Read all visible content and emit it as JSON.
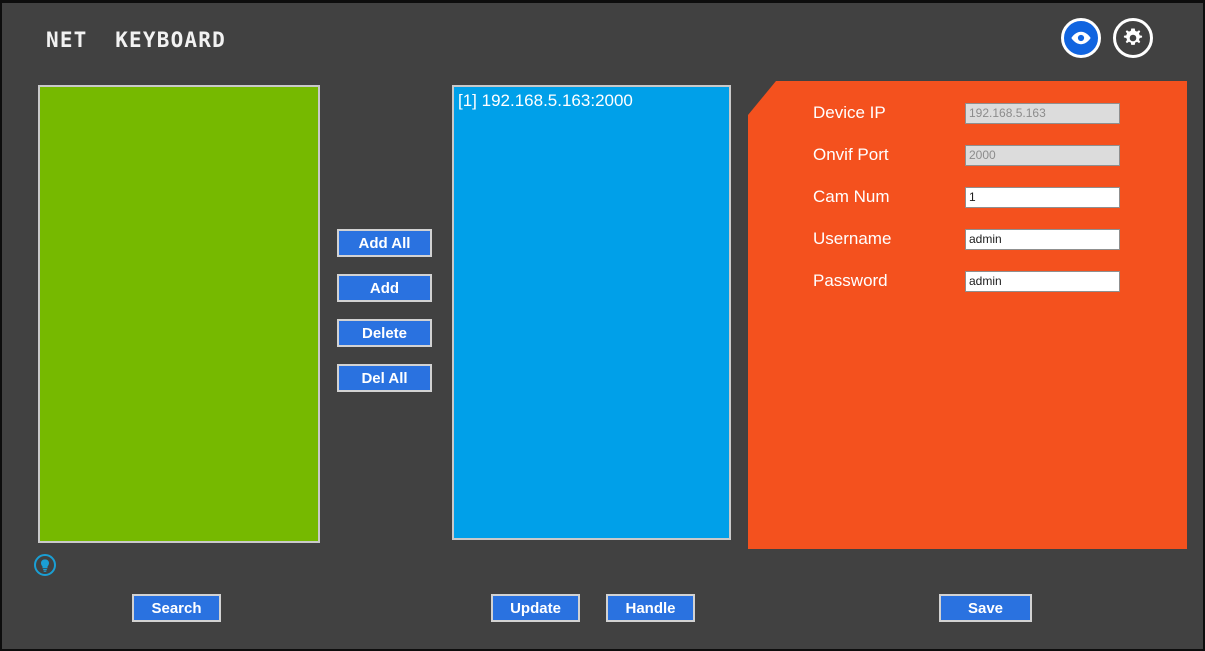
{
  "window": {
    "title": "NET  KEYBOARD",
    "background_color": "#414141"
  },
  "title_icons": [
    {
      "name": "eye-icon",
      "label": "Preview",
      "color": "#1064e0"
    },
    {
      "name": "gear-icon",
      "label": "Settings",
      "color": "#ffffff"
    }
  ],
  "device_list": {
    "name": "searched-device-list",
    "background_color": "#76b900",
    "items": []
  },
  "added_list": {
    "name": "added-device-list",
    "background_color": "#00a0e9",
    "items": [
      {
        "label": "[1] 192.168.5.163:2000"
      }
    ]
  },
  "transfer_buttons": [
    {
      "label": "Add All",
      "name": "add-all-button"
    },
    {
      "label": "Add",
      "name": "add-button"
    },
    {
      "label": "Delete",
      "name": "delete-button"
    },
    {
      "label": "Del All",
      "name": "del-all-button"
    }
  ],
  "settings_panel": {
    "background_color": "#f4511e",
    "fields": [
      {
        "label": "Device IP",
        "value": "192.168.5.163",
        "enabled": false
      },
      {
        "label": "Onvif Port",
        "value": "2000",
        "enabled": false
      },
      {
        "label": "Cam Num",
        "value": "1",
        "enabled": true
      },
      {
        "label": "Username",
        "value": "admin",
        "enabled": true
      },
      {
        "label": "Password",
        "value": "admin",
        "enabled": true
      }
    ]
  },
  "bottom_buttons": {
    "search": "Search",
    "update": "Update",
    "handle": "Handle",
    "save": "Save"
  },
  "status_indicator": {
    "name": "bulb-icon",
    "color": "#1a9fd4"
  }
}
